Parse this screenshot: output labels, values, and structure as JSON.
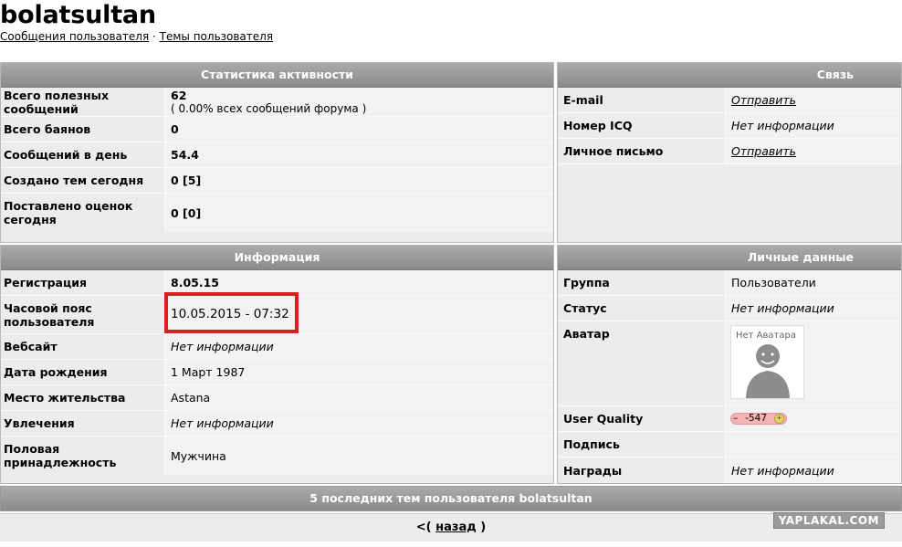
{
  "user": {
    "name": "bolatsultan",
    "links": {
      "messages": "Сообщения пользователя",
      "separator": "·",
      "topics": "Темы пользователя"
    }
  },
  "stats": {
    "title": "Статистика активности",
    "rows": [
      {
        "label": "Всего полезных сообщений",
        "value": "62",
        "note": "( 0.00% всех сообщений форума )"
      },
      {
        "label": "Всего баянов",
        "value": "0"
      },
      {
        "label": "Сообщений в день",
        "value": "54.4"
      },
      {
        "label": "Создано тем сегодня",
        "value": "0 [5]"
      },
      {
        "label": "Поставлено оценок сегодня",
        "value": "0 [0]"
      }
    ]
  },
  "contact": {
    "title": "Связь",
    "rows": [
      {
        "label": "E-mail",
        "value": "Отправить"
      },
      {
        "label": "Номер ICQ",
        "value": "Нет информации"
      },
      {
        "label": "Личное письмо",
        "value": "Отправить"
      }
    ]
  },
  "info": {
    "title": "Информация",
    "rows": [
      {
        "label": "Регистрация",
        "value": "8.05.15"
      },
      {
        "label": "Часовой пояс пользователя",
        "value": "10.05.2015 - 07:32"
      },
      {
        "label": "Вебсайт",
        "value": "Нет информации"
      },
      {
        "label": "Дата рождения",
        "value": "1 Март 1987"
      },
      {
        "label": "Место жительства",
        "value": "Astana"
      },
      {
        "label": "Увлечения",
        "value": "Нет информации"
      },
      {
        "label": "Половая принадлежность",
        "value": "Мужчина"
      }
    ]
  },
  "personal": {
    "title": "Личные данные",
    "rows": [
      {
        "label": "Группа",
        "value": "Пользователи"
      },
      {
        "label": "Статус",
        "value": "Нет информации"
      },
      {
        "label": "Аватар",
        "value": "Нет Аватара"
      },
      {
        "label": "User Quality",
        "minus": "–",
        "value": "-547",
        "plus": "+"
      },
      {
        "label": "Подпись",
        "value": ""
      },
      {
        "label": "Награды",
        "value": "Нет информации"
      }
    ]
  },
  "recent": {
    "title": "5 последних тем пользователя bolatsultan"
  },
  "back": {
    "prefix": "<(",
    "link": "назад",
    "suffix": ")"
  },
  "watermark": "YAPLAKAL.COM",
  "colors": {
    "highlight": "#d81e1e",
    "header": "#9a9a9a",
    "uq_badge": "#f5b3b3"
  }
}
